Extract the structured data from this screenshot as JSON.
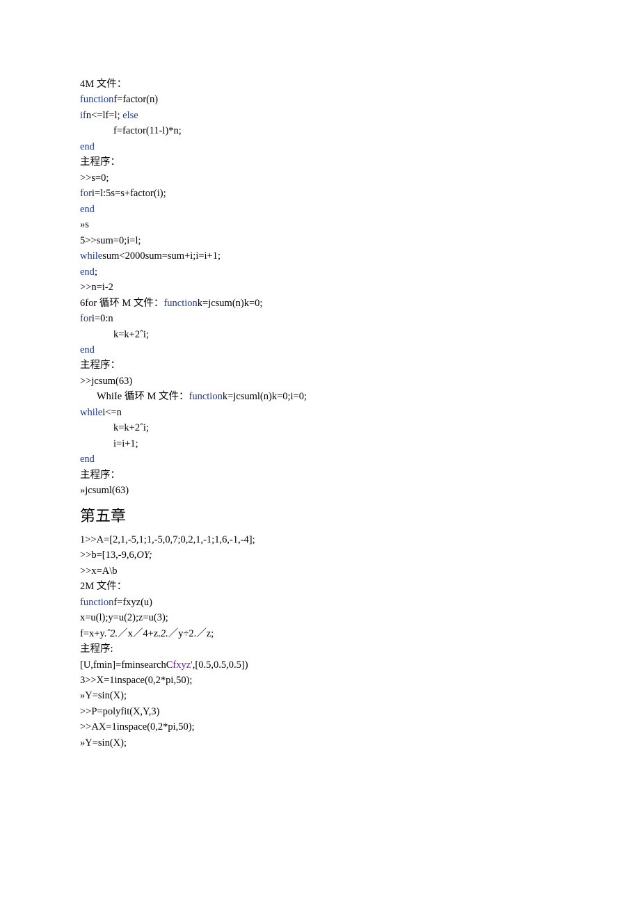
{
  "lines": [
    {
      "cls": "",
      "segs": [
        {
          "t": "4M 文件："
        }
      ]
    },
    {
      "cls": "",
      "segs": [
        {
          "t": "function",
          "c": "kw"
        },
        {
          "t": "f=factor(n)"
        }
      ]
    },
    {
      "cls": "",
      "segs": [
        {
          "t": "if",
          "c": "kw"
        },
        {
          "t": "n<=lf=l; "
        },
        {
          "t": "else",
          "c": "kw"
        }
      ]
    },
    {
      "cls": "indent1",
      "segs": [
        {
          "t": "f=factor(11-l)*n;"
        }
      ]
    },
    {
      "cls": "",
      "segs": [
        {
          "t": "end",
          "c": "kw"
        }
      ]
    },
    {
      "cls": "",
      "segs": [
        {
          "t": "主程序："
        }
      ]
    },
    {
      "cls": "",
      "segs": [
        {
          "t": ">>s=0;"
        }
      ]
    },
    {
      "cls": "",
      "segs": [
        {
          "t": "for",
          "c": "kw"
        },
        {
          "t": "i=l:5s=s+factor(i);"
        }
      ]
    },
    {
      "cls": "",
      "segs": [
        {
          "t": "end",
          "c": "kw"
        }
      ]
    },
    {
      "cls": "",
      "segs": [
        {
          "t": "»s"
        }
      ]
    },
    {
      "cls": "",
      "segs": [
        {
          "t": "5>>sum=0;i=l;"
        }
      ]
    },
    {
      "cls": "",
      "segs": [
        {
          "t": "while",
          "c": "kw"
        },
        {
          "t": "sum<2000sum=sum+i;i=i+1;"
        }
      ]
    },
    {
      "cls": "",
      "segs": [
        {
          "t": "end",
          "c": "kw"
        },
        {
          "t": ";"
        }
      ]
    },
    {
      "cls": "",
      "segs": [
        {
          "t": ">>n=i-2"
        }
      ]
    },
    {
      "cls": "",
      "segs": [
        {
          "t": "6for 循环 M 文件："
        },
        {
          "t": "function",
          "c": "kw"
        },
        {
          "t": "k=jcsum(n)k=0;"
        }
      ]
    },
    {
      "cls": "",
      "segs": [
        {
          "t": "for",
          "c": "kw"
        },
        {
          "t": "i=0:n"
        }
      ]
    },
    {
      "cls": "indent1",
      "segs": [
        {
          "t": "k=k+2ˆi;"
        }
      ]
    },
    {
      "cls": "",
      "segs": [
        {
          "t": "end",
          "c": "kw"
        }
      ]
    },
    {
      "cls": "",
      "segs": [
        {
          "t": "主程序："
        }
      ]
    },
    {
      "cls": "",
      "segs": [
        {
          "t": ">>jcsum(63)"
        }
      ]
    },
    {
      "cls": "indent-s",
      "segs": [
        {
          "t": "WhiIe 循环 M 文件："
        },
        {
          "t": "function",
          "c": "kw"
        },
        {
          "t": "k=jcsuml(n)k=0;i=0;"
        }
      ]
    },
    {
      "cls": "",
      "segs": [
        {
          "t": "while",
          "c": "kw"
        },
        {
          "t": "i<=n"
        }
      ]
    },
    {
      "cls": "indent1",
      "segs": [
        {
          "t": "k=k+2ˆi;"
        }
      ]
    },
    {
      "cls": "indent1",
      "segs": [
        {
          "t": "i=i+1;"
        }
      ]
    },
    {
      "cls": "",
      "segs": [
        {
          "t": "end",
          "c": "kw"
        }
      ]
    },
    {
      "cls": "",
      "segs": [
        {
          "t": "主程序："
        }
      ]
    },
    {
      "cls": "",
      "segs": [
        {
          "t": "»jcsuml(63)"
        }
      ]
    }
  ],
  "heading": "第五章",
  "lines2": [
    {
      "cls": "",
      "segs": [
        {
          "t": "1>>A=[2,1,-5,1;1,-5,0,7;0,2,1,-1;1,6,-1,-4];"
        }
      ]
    },
    {
      "cls": "",
      "segs": [
        {
          "t": ">>b=[13,-9,6,"
        },
        {
          "t": "OY;",
          "c": "it"
        }
      ]
    },
    {
      "cls": "",
      "segs": [
        {
          "t": ">>x=A\\b"
        }
      ]
    },
    {
      "cls": "",
      "segs": [
        {
          "t": "2M 文件："
        }
      ]
    },
    {
      "cls": "",
      "segs": [
        {
          "t": "function",
          "c": "kw"
        },
        {
          "t": "f=fxyz(u)"
        }
      ]
    },
    {
      "cls": "",
      "segs": [
        {
          "t": "x=u(l);y=u(2);z=u(3);"
        }
      ]
    },
    {
      "cls": "",
      "segs": [
        {
          "t": "f=x+y."
        },
        {
          "t": "ˆ2.",
          "c": "it"
        },
        {
          "t": "／x／4+z."
        },
        {
          "t": "2.",
          "c": "it"
        },
        {
          "t": "／y÷2.／z;"
        }
      ]
    },
    {
      "cls": "",
      "segs": [
        {
          "t": "主程序:"
        }
      ]
    },
    {
      "cls": "",
      "segs": [
        {
          "t": "[U,fmin]=fminsearchC"
        },
        {
          "t": "fxyz'",
          "c": "str"
        },
        {
          "t": ",[0.5,0.5,0.5])"
        }
      ]
    },
    {
      "cls": "",
      "segs": [
        {
          "t": "3>>X=1inspace(0,2*pi,50);"
        }
      ]
    },
    {
      "cls": "",
      "segs": [
        {
          "t": "»Y=sin(X);"
        }
      ]
    },
    {
      "cls": "",
      "segs": [
        {
          "t": ">>P=polyfit(X,Y,3)"
        }
      ]
    },
    {
      "cls": "",
      "segs": [
        {
          "t": ">>AX=1inspace(0,2*pi,50);"
        }
      ]
    },
    {
      "cls": "",
      "segs": [
        {
          "t": "»Y=sin(X);"
        }
      ]
    }
  ]
}
